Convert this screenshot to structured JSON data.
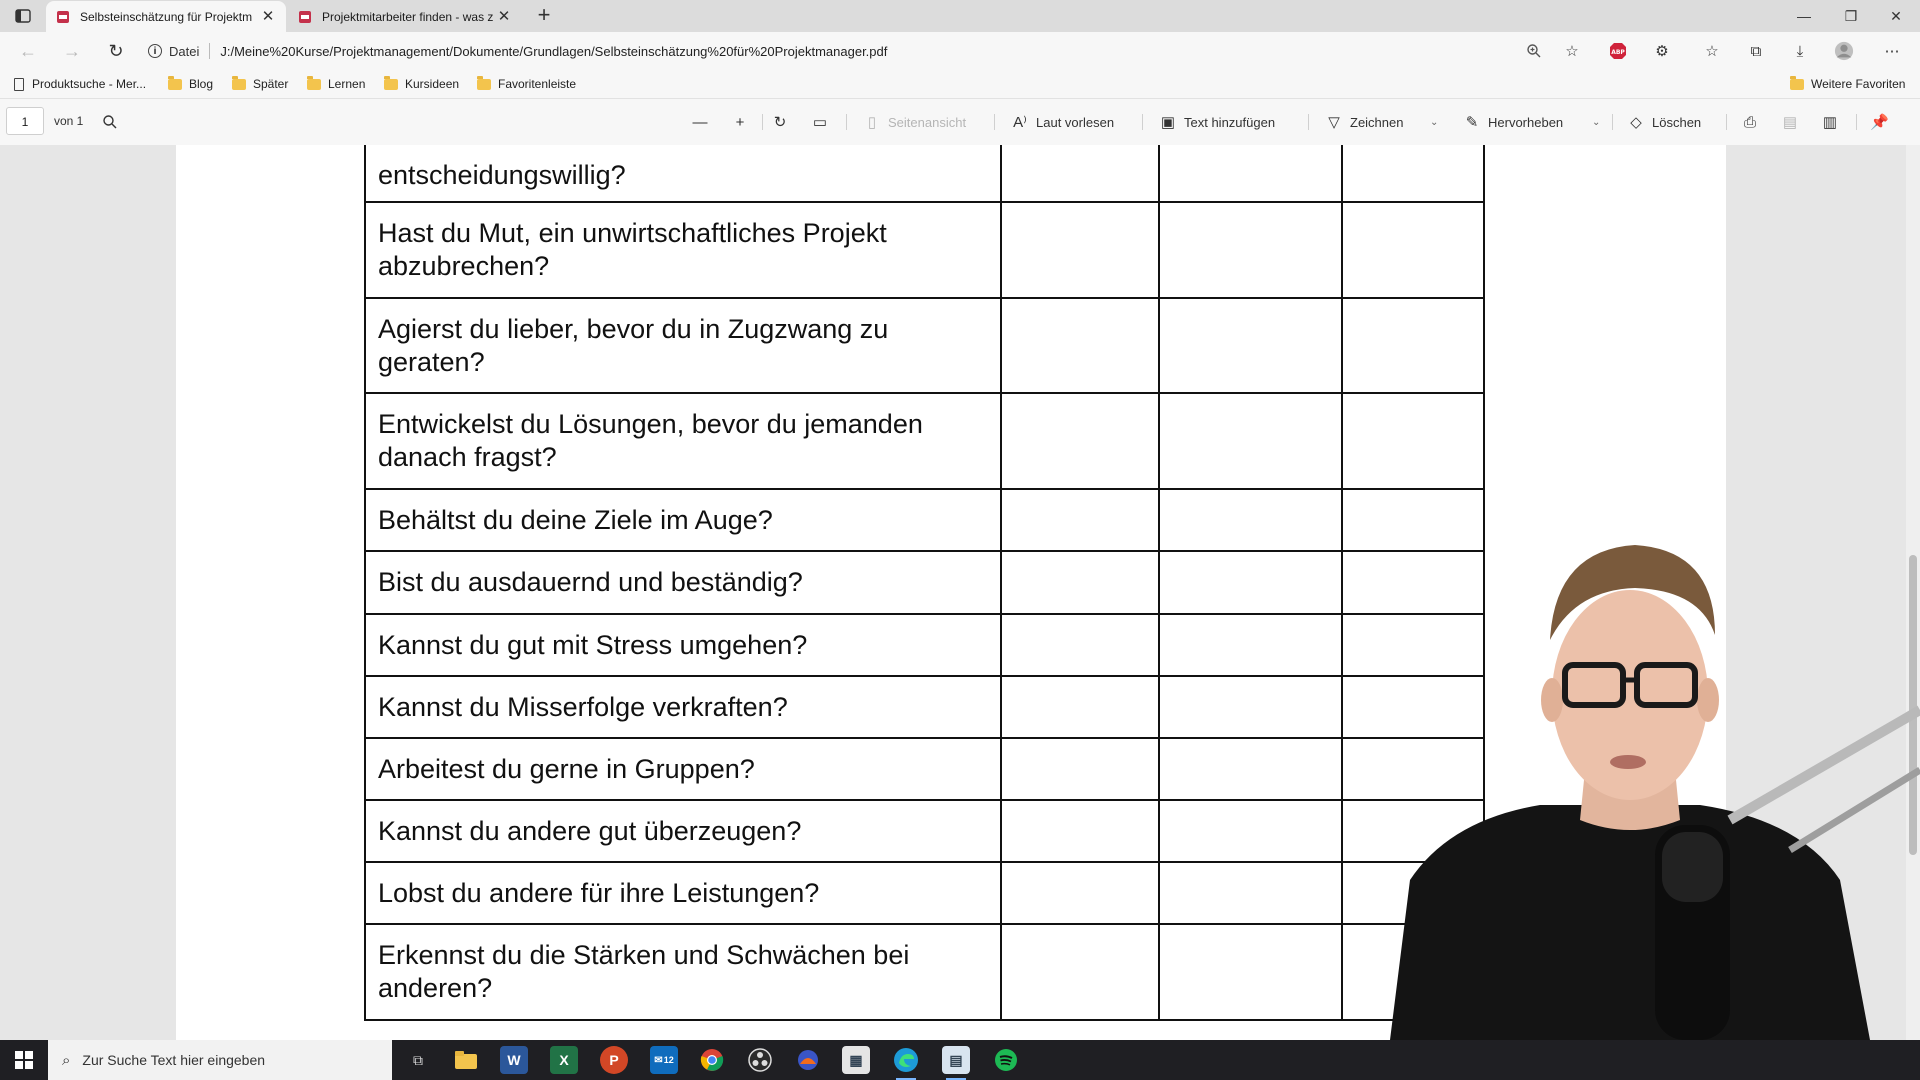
{
  "browser": {
    "tabs": [
      {
        "title": "Selbsteinschätzung für Projektm",
        "active": true
      },
      {
        "title": "Projektmitarbeiter finden - was z",
        "active": false
      }
    ],
    "address": {
      "scheme_label": "Datei",
      "url": "J:/Meine%20Kurse/Projektmanagement/Dokumente/Grundlagen/Selbsteinschätzung%20für%20Projektmanager.pdf"
    },
    "favorites": [
      {
        "label": "Produktsuche - Mer...",
        "icon": "page-icon"
      },
      {
        "label": "Blog",
        "icon": "folder-icon"
      },
      {
        "label": "Später",
        "icon": "folder-icon"
      },
      {
        "label": "Lernen",
        "icon": "folder-icon"
      },
      {
        "label": "Kursideen",
        "icon": "folder-icon"
      },
      {
        "label": "Favoritenleiste",
        "icon": "folder-icon"
      }
    ],
    "other_favorites": "Weitere Favoriten"
  },
  "pdf_toolbar": {
    "page_number": "1",
    "page_count": "von 1",
    "page_view": "Seitenansicht",
    "read_aloud": "Laut vorlesen",
    "add_text": "Text hinzufügen",
    "draw": "Zeichnen",
    "highlight": "Hervorheben",
    "erase": "Löschen"
  },
  "document": {
    "questions": [
      "entscheidungswillig?",
      "Hast du Mut, ein unwirtschaftliches Projekt abzubrechen?",
      "Agierst du lieber, bevor du in Zugzwang zu geraten?",
      "Entwickelst du Lösungen, bevor du jemanden danach fragst?",
      "Behältst du deine Ziele im Auge?",
      "Bist du ausdauernd und beständig?",
      "Kannst du gut mit Stress umgehen?",
      "Kannst du Misserfolge verkraften?",
      "Arbeitest du gerne in Gruppen?",
      "Kannst du andere gut überzeugen?",
      "Lobst du andere für ihre Leistungen?",
      "Erkennst du die Stärken und Schwächen bei anderen?"
    ]
  },
  "taskbar": {
    "search_placeholder": "Zur Suche Text hier eingeben",
    "mail_badge": "12"
  },
  "colors": {
    "pdf_favicon": "#c4314b",
    "word": "#2b579a",
    "excel": "#217346",
    "powerpoint": "#d24726",
    "spotify": "#1db954",
    "edge": "#1d9bd7"
  }
}
